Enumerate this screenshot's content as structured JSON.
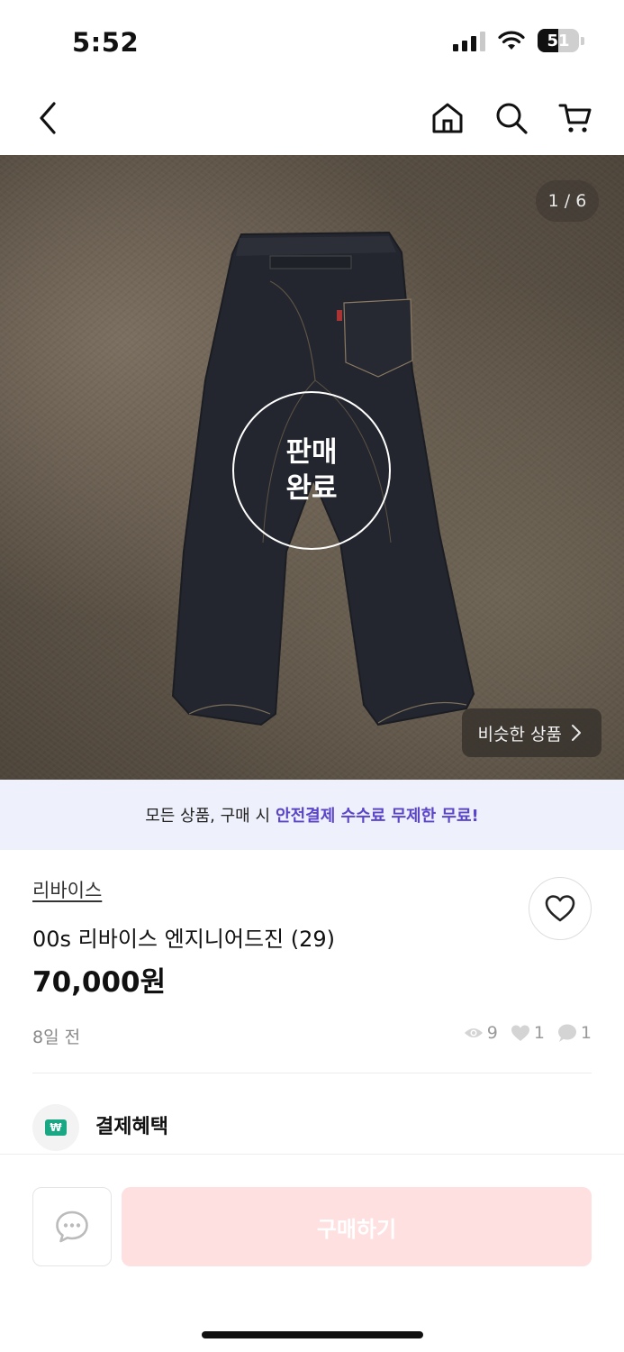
{
  "status_bar": {
    "time": "5:52",
    "battery": "51",
    "battery_level": 0.51
  },
  "nav": {
    "icons": [
      "back-arrow-icon",
      "home-icon",
      "search-icon",
      "cart-icon"
    ]
  },
  "gallery": {
    "counter": "1 / 6",
    "sold_line1": "판매",
    "sold_line2": "완료",
    "similar_button": "비슷한 상품",
    "similar_icon": "chevron-right-icon"
  },
  "promo": {
    "text": "모든 상품, 구매 시",
    "highlight": "안전결제 수수료 무제한 무료!",
    "highlight_color": "#5a45c9"
  },
  "product": {
    "brand": "리바이스",
    "title": "00s 리바이스 엔지니어드진 (29)",
    "price": "70,000원",
    "time_ago": "8일 전",
    "views": "9",
    "likes": "1",
    "comments": "1"
  },
  "benefit": {
    "label": "결제혜택",
    "icon_color": "#1aa884"
  },
  "bottom": {
    "buy_label": "구매하기",
    "buy_color": "#fde0df"
  }
}
